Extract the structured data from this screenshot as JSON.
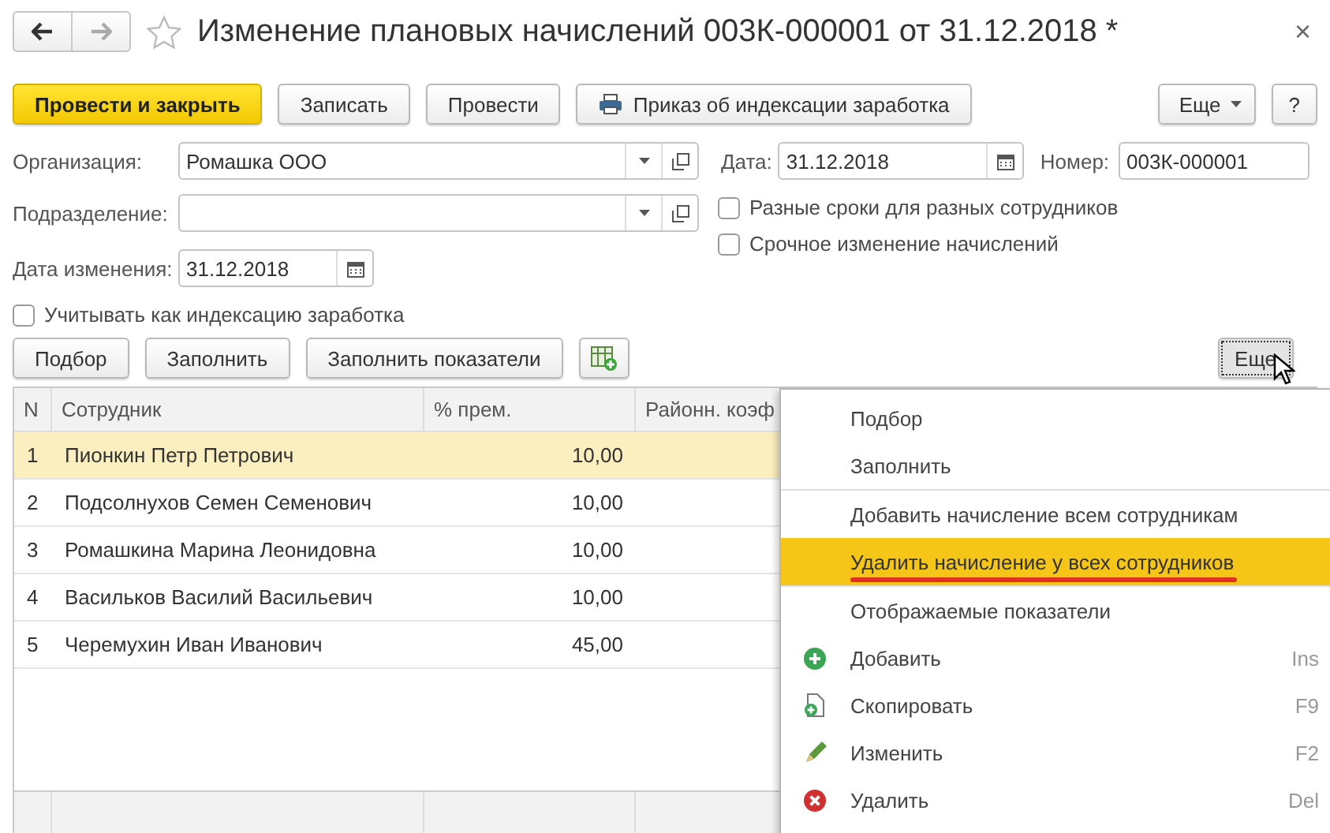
{
  "window": {
    "title": "Изменение плановых начислений 003К-000001 от 31.12.2018 *",
    "close": "×"
  },
  "commands": [
    {
      "label": "Провести и закрыть",
      "kind": "primary"
    },
    {
      "label": "Записать",
      "kind": "plain"
    },
    {
      "label": "Провести",
      "kind": "plain"
    },
    {
      "label": "Приказ об индексации заработка",
      "kind": "print"
    },
    {
      "label": "Еще",
      "kind": "more"
    },
    {
      "label": "?",
      "kind": "help"
    }
  ],
  "form": {
    "organization": {
      "label": "Организация:",
      "value": "Ромашка ООО"
    },
    "date": {
      "label": "Дата:",
      "value": "31.12.2018"
    },
    "number": {
      "label": "Номер:",
      "value": "003К-000001"
    },
    "department": {
      "label": "Подразделение:"
    },
    "change_date": {
      "label": "Дата изменения:",
      "value": "31.12.2018"
    },
    "checkboxes": [
      {
        "label": "Разные сроки для разных сотрудников",
        "checked": false
      },
      {
        "label": "Срочное изменение начислений",
        "checked": false
      }
    ],
    "index_checkbox": {
      "label": "Учитывать как индексацию заработка",
      "checked": false
    }
  },
  "table_toolbar": [
    {
      "label": "Подбор",
      "kind": "plain"
    },
    {
      "label": "Заполнить",
      "kind": "plain"
    },
    {
      "label": "Заполнить показатели",
      "kind": "plain"
    },
    {
      "kind": "add-column"
    },
    {
      "label": "Еще",
      "kind": "more-pressed"
    }
  ],
  "table": {
    "columns": [
      "N",
      "Сотрудник",
      "% прем.",
      "Районн. коэф"
    ],
    "rows": [
      {
        "n": "1",
        "employee": "Пионкин Петр Петрович",
        "bonus": "10,00",
        "selected": true
      },
      {
        "n": "2",
        "employee": "Подсолнухов Семен Семенович",
        "bonus": "10,00",
        "selected": false
      },
      {
        "n": "3",
        "employee": "Ромашкина Марина Леонидовна",
        "bonus": "10,00",
        "selected": false
      },
      {
        "n": "4",
        "employee": "Васильков Василий Васильевич",
        "bonus": "10,00",
        "selected": false
      },
      {
        "n": "5",
        "employee": "Черемухин Иван Иванович",
        "bonus": "45,00",
        "selected": false
      }
    ]
  },
  "menu": [
    {
      "label": "Подбор",
      "kind": "plain",
      "separator_before": false,
      "selected": false,
      "underlined": false
    },
    {
      "label": "Заполнить",
      "kind": "plain",
      "separator_before": false,
      "selected": false,
      "underlined": false
    },
    {
      "label": "Добавить начисление всем сотрудникам",
      "kind": "plain",
      "separator_before": true,
      "selected": false,
      "underlined": false
    },
    {
      "label": "Удалить начисление у всех сотрудников",
      "kind": "plain",
      "separator_before": false,
      "selected": true,
      "underlined": true
    },
    {
      "label": "Отображаемые показатели",
      "kind": "plain",
      "separator_before": true,
      "selected": false,
      "underlined": false
    },
    {
      "label": "Добавить",
      "kind": "add",
      "shortcut": "Ins",
      "separator_before": false,
      "selected": false,
      "underlined": false
    },
    {
      "label": "Скопировать",
      "kind": "copy",
      "shortcut": "F9",
      "separator_before": false,
      "selected": false,
      "underlined": false
    },
    {
      "label": "Изменить",
      "kind": "edit",
      "shortcut": "F2",
      "separator_before": false,
      "selected": false,
      "underlined": false
    },
    {
      "label": "Удалить",
      "kind": "delete",
      "shortcut": "Del",
      "separator_before": false,
      "selected": false,
      "underlined": false
    }
  ]
}
